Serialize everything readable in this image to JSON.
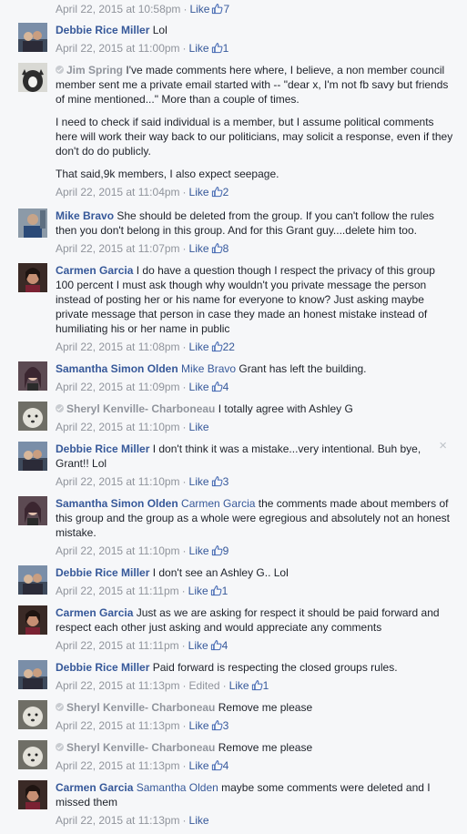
{
  "icons": {
    "like_thumb": "thumbs-up-icon",
    "verified": "check-badge-icon",
    "close": "close-icon"
  },
  "colors": {
    "link": "#365899",
    "meta": "#90949c",
    "background": "#f6f7f9"
  },
  "top": {
    "timestamp": "April 22, 2015 at 10:58pm",
    "like": "Like",
    "count": "7"
  },
  "close_x": "×",
  "comments": [
    {
      "author": "Debbie Rice Miller",
      "text": "Lol",
      "timestamp": "April 22, 2015 at 11:00pm",
      "like": "Like",
      "count": "1"
    },
    {
      "author": "Jim Spring",
      "text": "I've made comments here where, I believe, a non member council member sent me a private email started with -- \"dear x, I'm not fb savy but friends of mine mentioned...\" More than a couple of times.",
      "para2": "I need to check if said individual is a member, but I assume political comments here will work their way back to our politicians, may solicit a response, even if they don't do do publicly.",
      "para3": "That said,9k members, I also expect seepage.",
      "timestamp": "April 22, 2015 at 11:04pm",
      "like": "Like",
      "count": "2"
    },
    {
      "author": "Mike Bravo",
      "text": "She should be deleted from the group. If you can't follow the rules then you don't belong in this group. And for this Grant guy....delete him too.",
      "timestamp": "April 22, 2015 at 11:07pm",
      "like": "Like",
      "count": "8"
    },
    {
      "author": "Carmen Garcia",
      "text": "I do have a question though I respect the privacy of this group 100 percent I must ask though why wouldn't you private message the person instead of posting her or his name for everyone to know? Just asking maybe private message that person in case they made an honest mistake instead of humiliating his or her name in public",
      "timestamp": "April 22, 2015 at 11:08pm",
      "like": "Like",
      "count": "22"
    },
    {
      "author": "Samantha Simon Olden",
      "mention": "Mike Bravo",
      "text": "Grant has left the building.",
      "timestamp": "April 22, 2015 at 11:09pm",
      "like": "Like",
      "count": "4"
    },
    {
      "author": "Sheryl Kenville- Charboneau",
      "text": "I totally agree with Ashley G",
      "timestamp": "April 22, 2015 at 11:10pm",
      "like": "Like"
    },
    {
      "author": "Debbie Rice Miller",
      "text": "I don't think it was a mistake...very intentional. Buh bye, Grant!! Lol",
      "timestamp": "April 22, 2015 at 11:10pm",
      "like": "Like",
      "count": "3"
    },
    {
      "author": "Samantha Simon Olden",
      "mention": "Carmen Garcia",
      "text": "the comments made about members of this group and the group as a whole were egregious and absolutely not an honest mistake.",
      "timestamp": "April 22, 2015 at 11:10pm",
      "like": "Like",
      "count": "9"
    },
    {
      "author": "Debbie Rice Miller",
      "text": "I don't see an Ashley G.. Lol",
      "timestamp": "April 22, 2015 at 11:11pm",
      "like": "Like",
      "count": "1"
    },
    {
      "author": "Carmen Garcia",
      "text": "Just as we are asking for respect it should be paid forward and respect each other just asking and would appreciate any comments",
      "timestamp": "April 22, 2015 at 11:11pm",
      "like": "Like",
      "count": "4"
    },
    {
      "author": "Debbie Rice Miller",
      "text": "Paid forward is respecting the closed groups rules.",
      "timestamp": "April 22, 2015 at 11:13pm",
      "edited": "Edited",
      "like": "Like",
      "count": "1"
    },
    {
      "author": "Sheryl Kenville- Charboneau",
      "text": "Remove me please",
      "timestamp": "April 22, 2015 at 11:13pm",
      "like": "Like",
      "count": "3"
    },
    {
      "author": "Sheryl Kenville- Charboneau",
      "text": "Remove me please",
      "timestamp": "April 22, 2015 at 11:13pm",
      "like": "Like",
      "count": "4"
    },
    {
      "author": "Carmen Garcia",
      "mention": "Samantha Olden",
      "text": "maybe some comments were deleted and I missed them",
      "timestamp": "April 22, 2015 at 11:13pm",
      "like": "Like"
    }
  ]
}
